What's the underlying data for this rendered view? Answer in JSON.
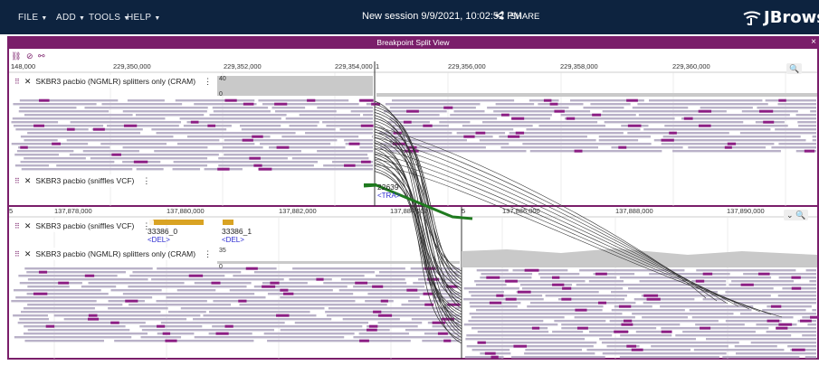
{
  "menu": {
    "file": "FILE",
    "add": "ADD",
    "tools": "TOOLS",
    "help": "HELP"
  },
  "session": {
    "title": "New session 9/9/2021, 10:02:52 PM",
    "share": "SHARE"
  },
  "brand": {
    "name": "JBrowse"
  },
  "view": {
    "title": "Breakpoint Split View",
    "close": "×"
  },
  "top_panel": {
    "chrom": "1",
    "chrom_right": "1",
    "ticks": [
      "148,000",
      "229,350,000",
      "229,352,000",
      "229,354,000",
      "229,356,000",
      "229,358,000",
      "229,360,000"
    ],
    "track_cram": "SKBR3 pacbio (NGMLR) splitters only (CRAM)",
    "track_vcf": "SKBR3 pacbio (sniffles VCF)",
    "coverage_max": "40",
    "coverage_min": "0",
    "feature_label": "22639",
    "feature_type": "<TRA>"
  },
  "bottom_panel": {
    "chrom": "5",
    "chrom_right": "5",
    "ticks": [
      "137,878,000",
      "137,880,000",
      "137,882,000",
      "137,884,000",
      "137,886,000",
      "137,888,000",
      "137,890,000"
    ],
    "track_vcf": "SKBR3 pacbio (sniffles VCF)",
    "track_cram": "SKBR3 pacbio (NGMLR) splitters only (CRAM)",
    "coverage_max": "35",
    "coverage_min": "0",
    "features": [
      {
        "label": "33386_0",
        "type": "<DEL>"
      },
      {
        "label": "33386_1",
        "type": "<DEL>"
      }
    ]
  },
  "colors": {
    "topbar": "#0d233f",
    "accent": "#7a1e6a",
    "read": "#b9b1c8",
    "split": "#8b1e84",
    "coverage": "#c9c9c9",
    "feature": "#d9a323",
    "link": "#1f7a1f"
  },
  "icons": {
    "share": "share-icon",
    "logo": "jbrowse-logo-icon",
    "link": "link-icon",
    "unlink": "no-link-icon",
    "drag": "drag-handle-icon",
    "close": "close-icon",
    "menu": "kebab-menu-icon",
    "zoom_in": "zoom-in-icon",
    "zoom_out": "zoom-out-icon"
  }
}
